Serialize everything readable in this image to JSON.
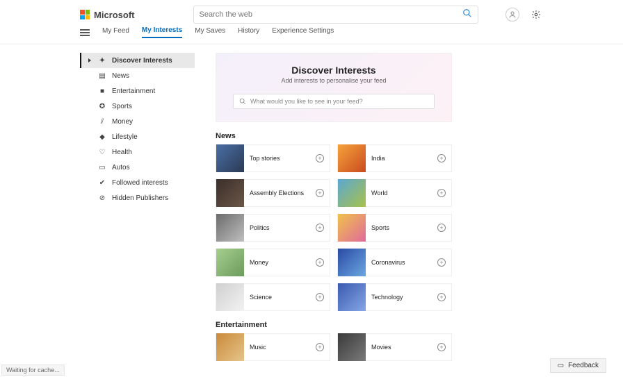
{
  "header": {
    "brand": "Microsoft",
    "search_placeholder": "Search the web"
  },
  "tabs": {
    "items": [
      "My Feed",
      "My Interests",
      "My Saves",
      "History",
      "Experience Settings"
    ],
    "active_index": 1
  },
  "sidebar": {
    "items": [
      {
        "label": "Discover Interests",
        "icon": "discover-icon",
        "selected": true
      },
      {
        "label": "News",
        "icon": "news-icon"
      },
      {
        "label": "Entertainment",
        "icon": "entertainment-icon"
      },
      {
        "label": "Sports",
        "icon": "sports-icon"
      },
      {
        "label": "Money",
        "icon": "money-icon"
      },
      {
        "label": "Lifestyle",
        "icon": "lifestyle-icon"
      },
      {
        "label": "Health",
        "icon": "health-icon"
      },
      {
        "label": "Autos",
        "icon": "autos-icon"
      },
      {
        "label": "Followed interests",
        "icon": "followed-icon"
      },
      {
        "label": "Hidden Publishers",
        "icon": "hidden-icon"
      }
    ]
  },
  "hero": {
    "title": "Discover Interests",
    "subtitle": "Add interests to personalise your feed",
    "search_placeholder": "What would you like to see in your feed?"
  },
  "sections": [
    {
      "title": "News",
      "cards": [
        {
          "label": "Top stories"
        },
        {
          "label": "India"
        },
        {
          "label": "Assembly Elections"
        },
        {
          "label": "World"
        },
        {
          "label": "Politics"
        },
        {
          "label": "Sports"
        },
        {
          "label": "Money"
        },
        {
          "label": "Coronavirus"
        },
        {
          "label": "Science"
        },
        {
          "label": "Technology"
        }
      ]
    },
    {
      "title": "Entertainment",
      "cards": [
        {
          "label": "Music"
        },
        {
          "label": "Movies"
        }
      ]
    }
  ],
  "status_bar": "Waiting for cache...",
  "feedback_label": "Feedback"
}
